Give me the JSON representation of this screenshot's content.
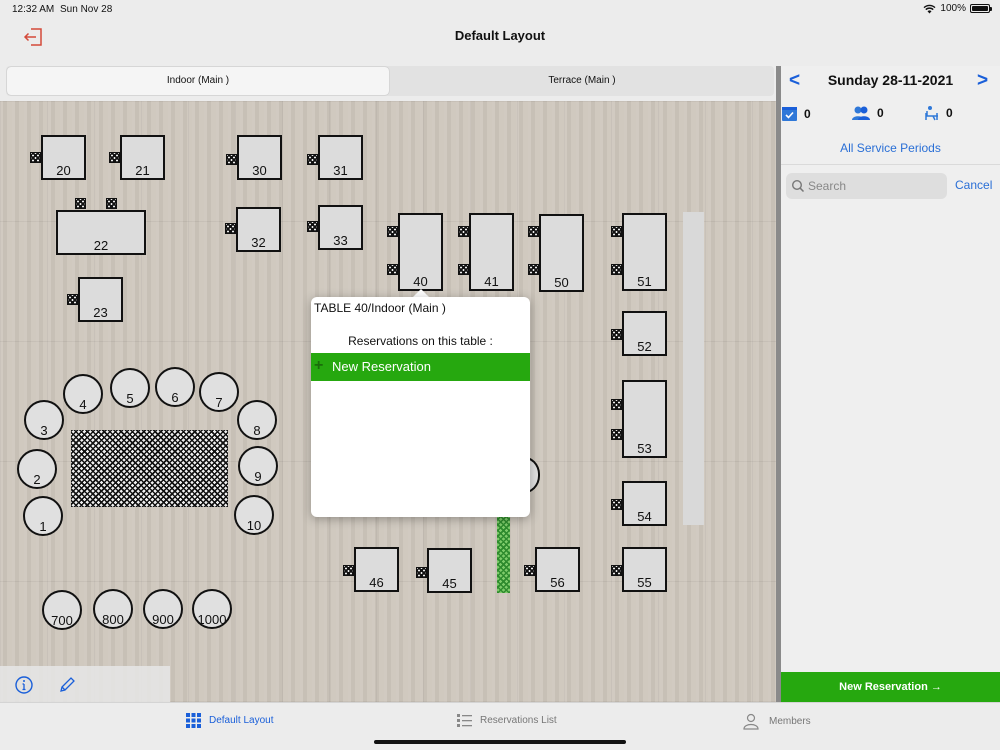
{
  "status_bar": {
    "time": "12:32 AM",
    "date": "Sun Nov 28",
    "battery": "100%"
  },
  "header": {
    "title": "Default Layout",
    "exit_icon": "exit-icon"
  },
  "area_tabs": [
    {
      "label": "Indoor (Main )",
      "active": true
    },
    {
      "label": "Terrace (Main )",
      "active": false
    }
  ],
  "floor": {
    "tables": [
      "20",
      "21",
      "22",
      "23",
      "30",
      "31",
      "32",
      "33",
      "40",
      "41",
      "50",
      "51",
      "52",
      "53",
      "54",
      "46",
      "45",
      "56",
      "55"
    ],
    "round_tables": [
      "1",
      "2",
      "3",
      "4",
      "5",
      "6",
      "7",
      "8",
      "9",
      "10",
      "700",
      "800",
      "900",
      "1000"
    ]
  },
  "popover": {
    "title": "TABLE 40/Indoor (Main )",
    "subtitle": "Reservations on this table :",
    "new_reservation_label": "New Reservation"
  },
  "panel": {
    "date_label": "Sunday 28-11-2021",
    "prev_label": "<",
    "next_label": ">",
    "stats": {
      "reservations": "0",
      "guests": "0",
      "seated": "0"
    },
    "service_periods": "All Service Periods",
    "search_placeholder": "Search",
    "cancel_label": "Cancel",
    "new_reservation_button": "New Reservation →"
  },
  "tabbar": [
    {
      "label": "Default Layout",
      "active": true
    },
    {
      "label": "Reservations List",
      "active": false
    },
    {
      "label": "Members",
      "active": false
    }
  ],
  "colors": {
    "accent_blue": "#1a5fd9",
    "accent_green": "#26a80f",
    "floor_wood": "#cdc6bc"
  }
}
